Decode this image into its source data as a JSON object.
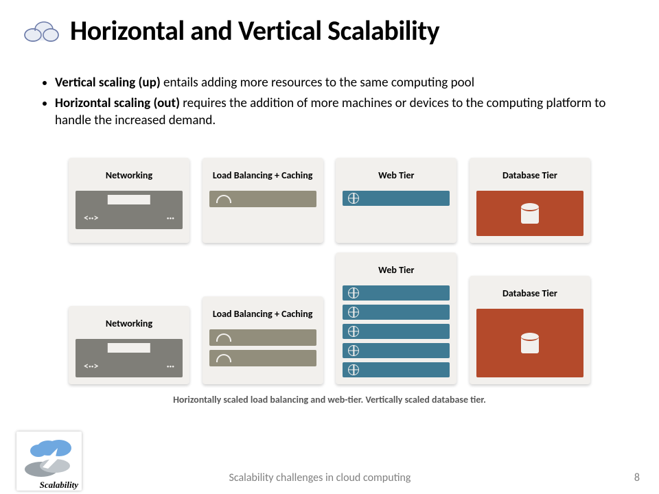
{
  "title": "Horizontal and Vertical Scalability",
  "bullets": {
    "vertical": {
      "bold": "Vertical scaling (up)",
      "rest": " entails adding more resources to the same computing pool"
    },
    "horizontal": {
      "bold": "Horizontal scaling (out)",
      "rest": " requires the addition of more machines or devices to the computing platform to handle the increased demand."
    }
  },
  "labels": {
    "networking": "Networking",
    "loadbalancing": "Load Balancing + Caching",
    "webtier": "Web Tier",
    "dbtier": "Database Tier"
  },
  "caption": "Horizontally scaled load balancing and web-tier.   Vertically scaled database tier.",
  "footer": {
    "text": "Scalability challenges in cloud computing",
    "page": "8"
  },
  "badge": {
    "label": "Scalability"
  }
}
